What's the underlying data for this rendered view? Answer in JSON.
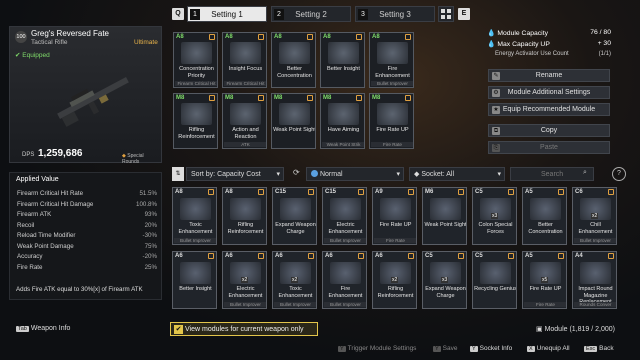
{
  "tabs": {
    "left_key": "Q",
    "right_key": "E",
    "items": [
      {
        "num": "1",
        "label": "Setting 1"
      },
      {
        "num": "2",
        "label": "Setting 2"
      },
      {
        "num": "3",
        "label": "Setting 3"
      }
    ]
  },
  "weapon": {
    "level": "100",
    "name": "Greg's Reversed Fate",
    "type": "Tactical Rifle",
    "rarity": "Ultimate",
    "equipped": "Equipped",
    "dps_label": "DPS",
    "dps_value": "1,259,686",
    "special": "Special Rounds"
  },
  "applied": {
    "title": "Applied Value",
    "stats": [
      {
        "name": "Firearm Critical Hit Rate",
        "value": "51.5%"
      },
      {
        "name": "Firearm Critical Hit Damage",
        "value": "100.8%"
      },
      {
        "name": "Firearm ATK",
        "value": "93%"
      },
      {
        "name": "Recoil",
        "value": "20%"
      },
      {
        "name": "Reload Time Modifier",
        "value": "-30%"
      },
      {
        "name": "Weak Point Damage",
        "value": "75%"
      },
      {
        "name": "Accuracy",
        "value": "-20%"
      },
      {
        "name": "Fire Rate",
        "value": "25%"
      }
    ],
    "note": "Adds Fire ATK equal to 30%[x] of Firearm ATK"
  },
  "equipped_slots": [
    {
      "cap": "A8",
      "name": "Concentration Priority",
      "sub": "Firearm Critical Hit"
    },
    {
      "cap": "A8",
      "name": "Insight Focus",
      "sub": "Firearm Critical Hit"
    },
    {
      "cap": "A8",
      "name": "Better Concentration",
      "sub": ""
    },
    {
      "cap": "A8",
      "name": "Better Insight",
      "sub": ""
    },
    {
      "cap": "A8",
      "name": "Fire Enhancement",
      "sub": "Bullet Improver"
    },
    {
      "cap": "M8",
      "name": "Rifling Reinforcement",
      "sub": ""
    },
    {
      "cap": "M8",
      "name": "Action and Reaction",
      "sub": "ATK"
    },
    {
      "cap": "M8",
      "name": "Weak Point Sight",
      "sub": ""
    },
    {
      "cap": "M8",
      "name": "Have Aiming",
      "sub": "Weak Point Strik"
    },
    {
      "cap": "M8",
      "name": "Fire Rate UP",
      "sub": "Fire Rate"
    }
  ],
  "capacity": {
    "label": "Module Capacity",
    "value": "76 / 80",
    "max_label": "Max Capacity UP",
    "max_value": "+ 30",
    "activator_label": "Energy Activator Use Count",
    "activator_value": "(1/1)"
  },
  "actions": [
    "Rename",
    "Module Additional Settings",
    "Equip Recommended Module",
    "Copy",
    "Paste"
  ],
  "filters": {
    "sort": "Sort by: Capacity Cost",
    "tier": "Normal",
    "socket": "Socket: All",
    "search_placeholder": "Search"
  },
  "inventory": [
    {
      "cap": "A8",
      "name": "Toxic Enhancement",
      "sub": "Bullet Improver",
      "count": ""
    },
    {
      "cap": "A8",
      "name": "Rifling Reinforcement",
      "sub": "",
      "count": ""
    },
    {
      "cap": "C15",
      "name": "Expand Weapon Charge",
      "sub": "",
      "count": ""
    },
    {
      "cap": "C15",
      "name": "Electric Enhancement",
      "sub": "Bullet Improver",
      "count": ""
    },
    {
      "cap": "A9",
      "name": "Fire Rate UP",
      "sub": "Fire Rate",
      "count": ""
    },
    {
      "cap": "M6",
      "name": "Weak Point Sight",
      "sub": "",
      "count": ""
    },
    {
      "cap": "C5",
      "name": "Colon Special Forces",
      "sub": "",
      "count": "x3"
    },
    {
      "cap": "A5",
      "name": "Better Concentration",
      "sub": "",
      "count": ""
    },
    {
      "cap": "C6",
      "name": "Chill Enhancement",
      "sub": "Bullet Improver",
      "count": "x2"
    },
    {
      "cap": "A6",
      "name": "Better Insight",
      "sub": "",
      "count": ""
    },
    {
      "cap": "A6",
      "name": "Electric Enhancement",
      "sub": "Bullet Improver",
      "count": "x2"
    },
    {
      "cap": "A6",
      "name": "Toxic Enhancement",
      "sub": "Bullet Improver",
      "count": "x2"
    },
    {
      "cap": "A6",
      "name": "Fire Enhancement",
      "sub": "Bullet Improver",
      "count": ""
    },
    {
      "cap": "A6",
      "name": "Rifling Reinforcement",
      "sub": "",
      "count": "x2"
    },
    {
      "cap": "C5",
      "name": "Expand Weapon Charge",
      "sub": "",
      "count": "x3"
    },
    {
      "cap": "C5",
      "name": "Recycling Genius",
      "sub": "",
      "count": ""
    },
    {
      "cap": "A5",
      "name": "Fire Rate UP",
      "sub": "Fire Rate",
      "count": "x5"
    },
    {
      "cap": "A4",
      "name": "Impact Round Magazine Replacement",
      "sub": "Rounds Conver",
      "count": ""
    }
  ],
  "bottom": {
    "weapon_info_key": "Tab",
    "weapon_info": "Weapon Info",
    "view_toggle": "View modules for current weapon only",
    "module_count": "Module (1,819 / 2,000)",
    "hints": [
      {
        "key": "Y",
        "label": "Trigger Module Settings"
      },
      {
        "key": "Y",
        "label": "Save"
      },
      {
        "key": "Y",
        "label": "Socket Info"
      },
      {
        "key": "X",
        "label": "Unequip All"
      },
      {
        "key": "Esc",
        "label": "Back"
      }
    ]
  },
  "colors": {
    "accent_green": "#7fdc6a",
    "rarity_gold": "#e8b34a",
    "toggle_yellow": "#e2c54b"
  }
}
